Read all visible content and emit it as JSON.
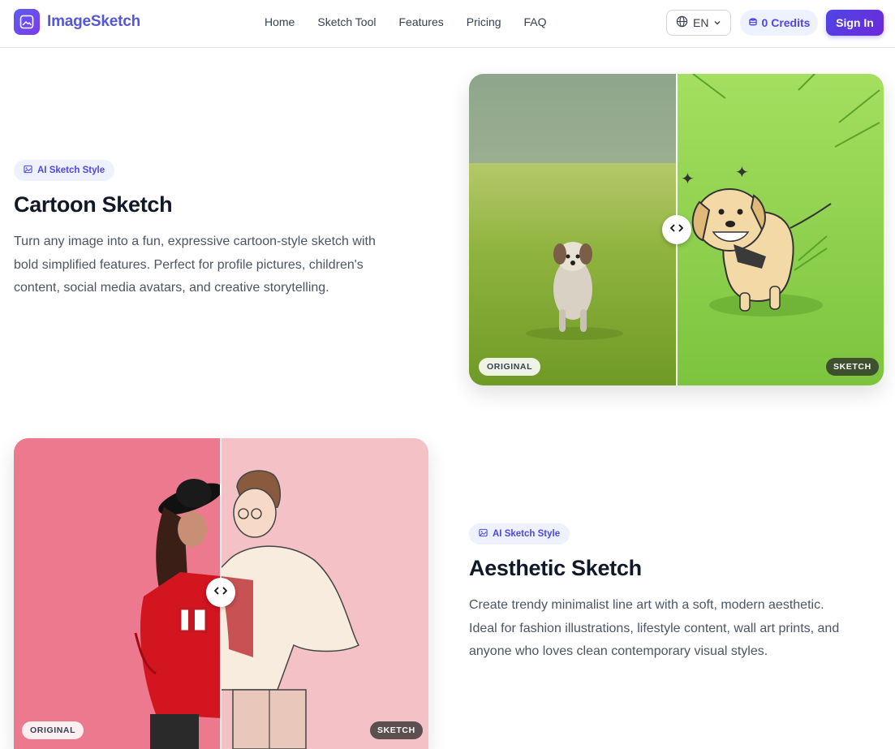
{
  "header": {
    "brand": "ImageSketch",
    "nav": [
      "Home",
      "Sketch Tool",
      "Features",
      "Pricing",
      "FAQ"
    ],
    "language": "EN",
    "credits": "0 Credits",
    "signin": "Sign In"
  },
  "sections": [
    {
      "badge": "AI Sketch Style",
      "title": "Cartoon Sketch",
      "desc_lines": [
        "Turn any image into a fun, expressive cartoon-style sketch with",
        "bold simplified features. Perfect for profile pictures, children's",
        "content, social media avatars, and creative storytelling."
      ],
      "label_original": "ORIGINAL",
      "label_sketch": "SKETCH"
    },
    {
      "badge": "AI Sketch Style",
      "title": "Aesthetic Sketch",
      "desc_lines": [
        "Create trendy minimalist line art with a soft, modern aesthetic.",
        "Ideal for fashion illustrations, lifestyle content, wall art prints, and",
        "anyone who loves clean contemporary visual styles."
      ],
      "label_original": "ORIGINAL",
      "label_sketch": "SKETCH"
    }
  ],
  "colors": {
    "brand": "#4f46e5",
    "badge_bg": "#eef2ff",
    "text": "#111827",
    "muted": "#4b5563"
  }
}
